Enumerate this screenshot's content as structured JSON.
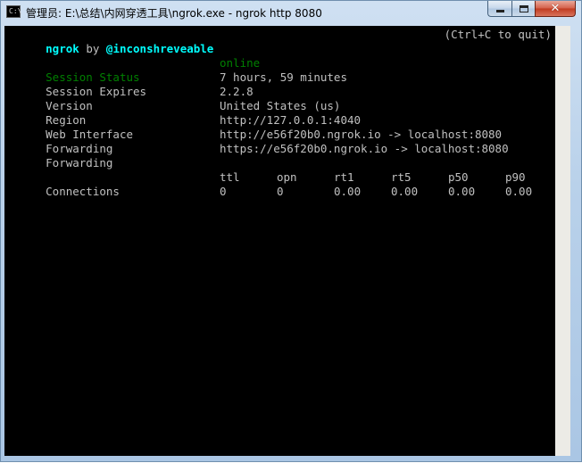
{
  "window": {
    "title": "管理员: E:\\总结\\内网穿透工具\\ngrok.exe - ngrok  http 8080",
    "icon": "console-app-icon",
    "icon_glyph": "C:\\"
  },
  "header": {
    "brand": "ngrok",
    "by": "by",
    "author": "@inconshreveable",
    "quit_hint": "(Ctrl+C to quit)"
  },
  "info": [
    {
      "label": "Session Status",
      "value": "online"
    },
    {
      "label": "Session Expires",
      "value": "7 hours, 59 minutes"
    },
    {
      "label": "Version",
      "value": "2.2.8"
    },
    {
      "label": "Region",
      "value": "United States (us)"
    },
    {
      "label": "Web Interface",
      "value": "http://127.0.0.1:4040"
    },
    {
      "label": "Forwarding",
      "value": "http://e56f20b0.ngrok.io -> localhost:8080"
    },
    {
      "label": "Forwarding",
      "value": "https://e56f20b0.ngrok.io -> localhost:8080"
    }
  ],
  "connections": {
    "label": "Connections",
    "headers": [
      "ttl",
      "opn",
      "rt1",
      "rt5",
      "p50",
      "p90"
    ],
    "values": [
      "0",
      "0",
      "0.00",
      "0.00",
      "0.00",
      "0.00"
    ]
  },
  "colors": {
    "terminal_bg": "#000000",
    "terminal_text": "#c0c0c0",
    "accent_cyan": "#00ffff",
    "status_green": "#008000"
  }
}
